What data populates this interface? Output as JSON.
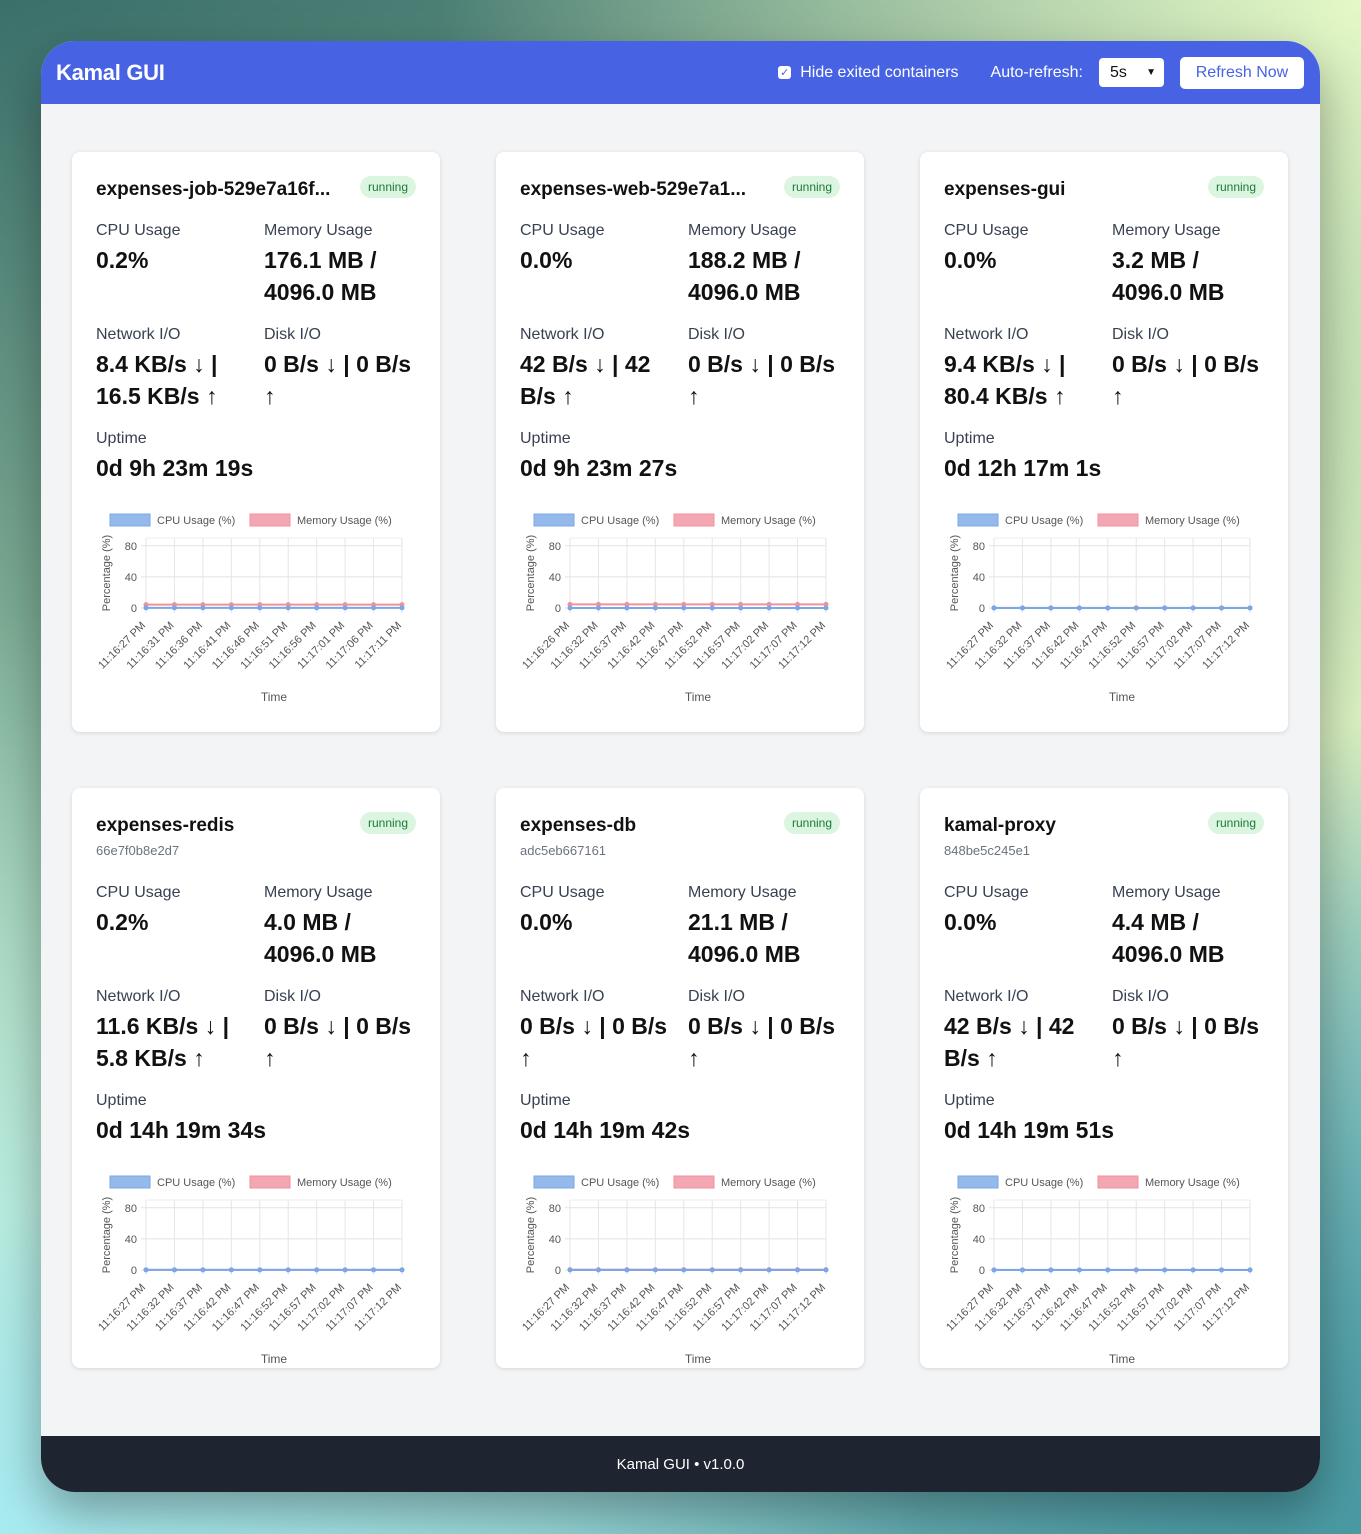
{
  "header": {
    "title": "Kamal GUI",
    "hide_exited_label": "Hide exited containers",
    "hide_exited_checked": true,
    "auto_refresh_label": "Auto-refresh:",
    "auto_refresh_value": "5s",
    "refresh_button": "Refresh Now"
  },
  "labels": {
    "cpu": "CPU Usage",
    "memory": "Memory Usage",
    "network": "Network I/O",
    "disk": "Disk I/O",
    "uptime": "Uptime"
  },
  "containers": [
    {
      "name": "expenses-job-529e7a16f...",
      "id": "",
      "status": "running",
      "cpu": "0.2%",
      "memory": "176.1 MB / 4096.0 MB",
      "network": "8.4 KB/s ↓ | 16.5 KB/s ↑",
      "disk": "0 B/s ↓ | 0 B/s ↑",
      "uptime": "0d 9h 23m 19s"
    },
    {
      "name": "expenses-web-529e7a1...",
      "id": "",
      "status": "running",
      "cpu": "0.0%",
      "memory": "188.2 MB / 4096.0 MB",
      "network": "42 B/s ↓ | 42 B/s ↑",
      "disk": "0 B/s ↓ | 0 B/s ↑",
      "uptime": "0d 9h 23m 27s"
    },
    {
      "name": "expenses-gui",
      "id": "",
      "status": "running",
      "cpu": "0.0%",
      "memory": "3.2 MB / 4096.0 MB",
      "network": "9.4 KB/s ↓ | 80.4 KB/s ↑",
      "disk": "0 B/s ↓ | 0 B/s ↑",
      "uptime": "0d 12h 17m 1s"
    },
    {
      "name": "expenses-redis",
      "id": "66e7f0b8e2d7",
      "status": "running",
      "cpu": "0.2%",
      "memory": "4.0 MB / 4096.0 MB",
      "network": "11.6 KB/s ↓ | 5.8 KB/s ↑",
      "disk": "0 B/s ↓ | 0 B/s ↑",
      "uptime": "0d 14h 19m 34s"
    },
    {
      "name": "expenses-db",
      "id": "adc5eb667161",
      "status": "running",
      "cpu": "0.0%",
      "memory": "21.1 MB / 4096.0 MB",
      "network": "0 B/s ↓ | 0 B/s ↑",
      "disk": "0 B/s ↓ | 0 B/s ↑",
      "uptime": "0d 14h 19m 42s"
    },
    {
      "name": "kamal-proxy",
      "id": "848be5c245e1",
      "status": "running",
      "cpu": "0.0%",
      "memory": "4.4 MB / 4096.0 MB",
      "network": "42 B/s ↓ | 42 B/s ↑",
      "disk": "0 B/s ↓ | 0 B/s ↑",
      "uptime": "0d 14h 19m 51s"
    }
  ],
  "chart_data": [
    {
      "type": "line",
      "x": [
        "11:16:27 PM",
        "11:16:31 PM",
        "11:16:36 PM",
        "11:16:41 PM",
        "11:16:46 PM",
        "11:16:51 PM",
        "11:16:56 PM",
        "11:17:01 PM",
        "11:17:06 PM",
        "11:17:11 PM"
      ],
      "series": [
        {
          "name": "CPU Usage (%)",
          "color": "#7aa7e6",
          "values": [
            0.2,
            0.2,
            0.2,
            0.2,
            0.2,
            0.2,
            0.2,
            0.2,
            0.2,
            0.2
          ]
        },
        {
          "name": "Memory Usage (%)",
          "color": "#f0919f",
          "values": [
            4.3,
            4.3,
            4.3,
            4.3,
            4.3,
            4.3,
            4.3,
            4.3,
            4.3,
            4.3
          ]
        }
      ],
      "xlabel": "Time",
      "ylabel": "Percentage (%)",
      "yticks": [
        0,
        40,
        80
      ],
      "ylim": [
        0,
        90
      ]
    },
    {
      "type": "line",
      "x": [
        "11:16:26 PM",
        "11:16:32 PM",
        "11:16:37 PM",
        "11:16:42 PM",
        "11:16:47 PM",
        "11:16:52 PM",
        "11:16:57 PM",
        "11:17:02 PM",
        "11:17:07 PM",
        "11:17:12 PM"
      ],
      "series": [
        {
          "name": "CPU Usage (%)",
          "color": "#7aa7e6",
          "values": [
            0.0,
            0.0,
            0.0,
            0.0,
            0.0,
            0.0,
            0.0,
            0.0,
            0.0,
            0.0
          ]
        },
        {
          "name": "Memory Usage (%)",
          "color": "#f0919f",
          "values": [
            4.6,
            4.6,
            4.6,
            4.6,
            4.6,
            4.6,
            4.6,
            4.6,
            4.6,
            4.6
          ]
        }
      ],
      "xlabel": "Time",
      "ylabel": "Percentage (%)",
      "yticks": [
        0,
        40,
        80
      ],
      "ylim": [
        0,
        90
      ]
    },
    {
      "type": "line",
      "x": [
        "11:16:27 PM",
        "11:16:32 PM",
        "11:16:37 PM",
        "11:16:42 PM",
        "11:16:47 PM",
        "11:16:52 PM",
        "11:16:57 PM",
        "11:17:02 PM",
        "11:17:07 PM",
        "11:17:12 PM"
      ],
      "series": [
        {
          "name": "CPU Usage (%)",
          "color": "#7aa7e6",
          "values": [
            0.0,
            0.0,
            0.0,
            0.0,
            0.0,
            0.0,
            0.0,
            0.0,
            0.0,
            0.0
          ]
        },
        {
          "name": "Memory Usage (%)",
          "color": "#f0919f",
          "values": [
            0.1,
            0.1,
            0.1,
            0.1,
            0.1,
            0.1,
            0.1,
            0.1,
            0.1,
            0.1
          ]
        }
      ],
      "xlabel": "Time",
      "ylabel": "Percentage (%)",
      "yticks": [
        0,
        40,
        80
      ],
      "ylim": [
        0,
        90
      ]
    },
    {
      "type": "line",
      "x": [
        "11:16:27 PM",
        "11:16:32 PM",
        "11:16:37 PM",
        "11:16:42 PM",
        "11:16:47 PM",
        "11:16:52 PM",
        "11:16:57 PM",
        "11:17:02 PM",
        "11:17:07 PM",
        "11:17:12 PM"
      ],
      "series": [
        {
          "name": "CPU Usage (%)",
          "color": "#7aa7e6",
          "values": [
            0.2,
            0.2,
            0.2,
            0.2,
            0.2,
            0.2,
            0.2,
            0.2,
            0.2,
            0.2
          ]
        },
        {
          "name": "Memory Usage (%)",
          "color": "#f0919f",
          "values": [
            0.1,
            0.1,
            0.1,
            0.1,
            0.1,
            0.1,
            0.1,
            0.1,
            0.1,
            0.1
          ]
        }
      ],
      "xlabel": "Time",
      "ylabel": "Percentage (%)",
      "yticks": [
        0,
        40,
        80
      ],
      "ylim": [
        0,
        90
      ]
    },
    {
      "type": "line",
      "x": [
        "11:16:27 PM",
        "11:16:32 PM",
        "11:16:37 PM",
        "11:16:42 PM",
        "11:16:47 PM",
        "11:16:52 PM",
        "11:16:57 PM",
        "11:17:02 PM",
        "11:17:07 PM",
        "11:17:12 PM"
      ],
      "series": [
        {
          "name": "CPU Usage (%)",
          "color": "#7aa7e6",
          "values": [
            0.0,
            0.0,
            0.0,
            0.0,
            0.0,
            0.0,
            0.0,
            0.0,
            0.0,
            0.0
          ]
        },
        {
          "name": "Memory Usage (%)",
          "color": "#f0919f",
          "values": [
            0.5,
            0.5,
            0.5,
            0.5,
            0.5,
            0.5,
            0.5,
            0.5,
            0.5,
            0.5
          ]
        }
      ],
      "xlabel": "Time",
      "ylabel": "Percentage (%)",
      "yticks": [
        0,
        40,
        80
      ],
      "ylim": [
        0,
        90
      ]
    },
    {
      "type": "line",
      "x": [
        "11:16:27 PM",
        "11:16:32 PM",
        "11:16:37 PM",
        "11:16:42 PM",
        "11:16:47 PM",
        "11:16:52 PM",
        "11:16:57 PM",
        "11:17:02 PM",
        "11:17:07 PM",
        "11:17:12 PM"
      ],
      "series": [
        {
          "name": "CPU Usage (%)",
          "color": "#7aa7e6",
          "values": [
            0.0,
            0.0,
            0.0,
            0.0,
            0.0,
            0.0,
            0.0,
            0.0,
            0.0,
            0.0
          ]
        },
        {
          "name": "Memory Usage (%)",
          "color": "#f0919f",
          "values": [
            0.1,
            0.1,
            0.1,
            0.1,
            0.1,
            0.1,
            0.1,
            0.1,
            0.1,
            0.1
          ]
        }
      ],
      "xlabel": "Time",
      "ylabel": "Percentage (%)",
      "yticks": [
        0,
        40,
        80
      ],
      "ylim": [
        0,
        90
      ]
    }
  ],
  "footer": {
    "text": "Kamal GUI • v1.0.0"
  }
}
